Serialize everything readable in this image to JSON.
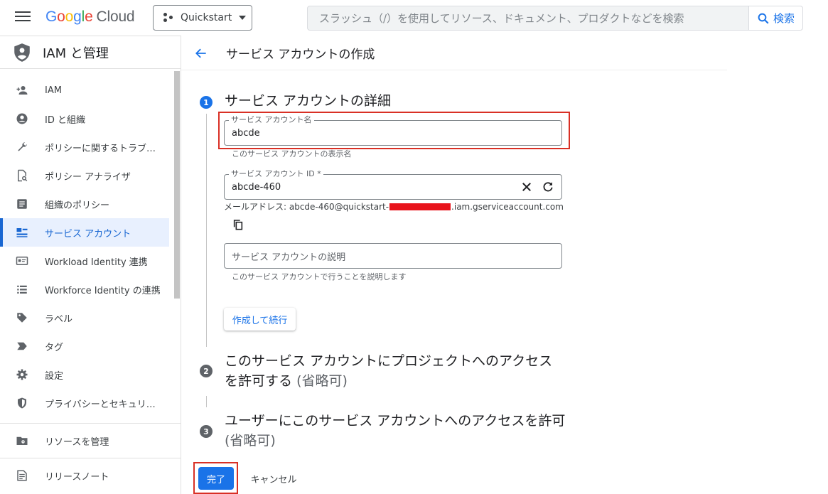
{
  "header": {
    "logo_google": "Google",
    "logo_cloud": "Cloud",
    "project": "Quickstart",
    "search_placeholder": "スラッシュ（/）を使用してリソース、ドキュメント、プロダクトなどを検索",
    "search_button": "検索"
  },
  "sidebar": {
    "title": "IAM と管理",
    "items": [
      {
        "label": "IAM",
        "icon": "person-add-icon"
      },
      {
        "label": "ID と組織",
        "icon": "account-circle-icon"
      },
      {
        "label": "ポリシーに関するトラブ…",
        "icon": "wrench-icon"
      },
      {
        "label": "ポリシー アナライザ",
        "icon": "document-search-icon"
      },
      {
        "label": "組織のポリシー",
        "icon": "list-document-icon"
      },
      {
        "label": "サービス アカウント",
        "icon": "service-account-icon",
        "active": true
      },
      {
        "label": "Workload Identity 連携",
        "icon": "id-card-icon"
      },
      {
        "label": "Workforce Identity の連携",
        "icon": "list-icon"
      },
      {
        "label": "ラベル",
        "icon": "tag-icon"
      },
      {
        "label": "タグ",
        "icon": "label-arrow-icon"
      },
      {
        "label": "設定",
        "icon": "gear-icon"
      },
      {
        "label": "プライバシーとセキュリ…",
        "icon": "shield-icon"
      }
    ],
    "footer_items": [
      {
        "label": "リソースを管理",
        "icon": "folder-gear-icon"
      },
      {
        "label": "リリースノート",
        "icon": "release-notes-icon"
      }
    ]
  },
  "page": {
    "title": "サービス アカウントの作成"
  },
  "steps": [
    {
      "number": "1",
      "title": "サービス アカウントの詳細",
      "optional": ""
    },
    {
      "number": "2",
      "title": "このサービス アカウントにプロジェクトへのアクセスを許可する",
      "optional": "(省略可)"
    },
    {
      "number": "3",
      "title": "ユーザーにこのサービス アカウントへのアクセスを許可",
      "optional": "(省略可)"
    }
  ],
  "form": {
    "name_label": "サービス アカウント名",
    "name_value": "abcde",
    "name_hint": "このサービス アカウントの表示名",
    "id_label": "サービス アカウント ID *",
    "id_value": "abcde-460",
    "email_prefix": "メールアドレス: abcde-460@quickstart-",
    "email_suffix": ".iam.gserviceaccount.com",
    "description_placeholder": "サービス アカウントの説明",
    "description_hint": "このサービス アカウントで行うことを説明します",
    "create_button": "作成して続行"
  },
  "actions": {
    "done": "完了",
    "cancel": "キャンセル"
  },
  "colors": {
    "accent": "#1a73e8",
    "highlight": "#d93025",
    "redaction": "#e8141c"
  }
}
